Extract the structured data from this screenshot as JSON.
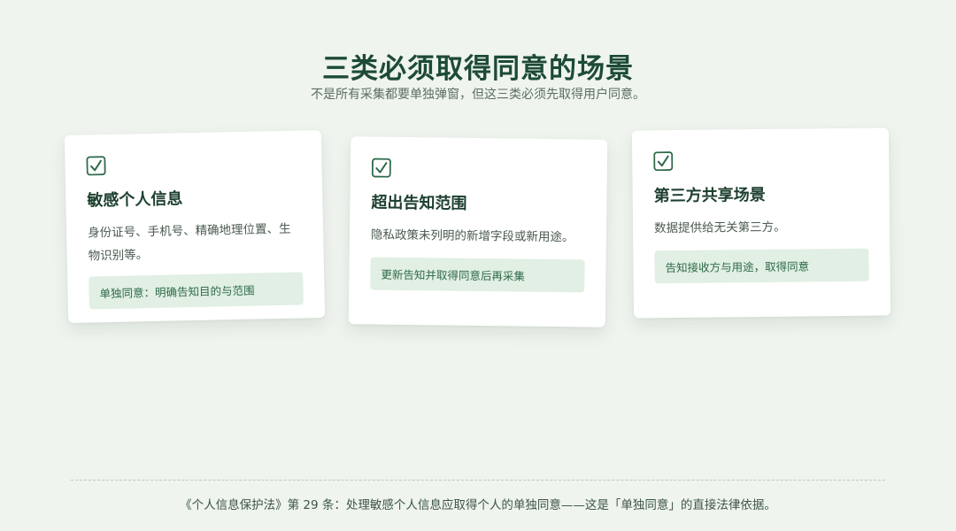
{
  "header": {
    "title": "三类必须取得同意的场景",
    "subtitle": "不是所有采集都要单独弹窗，但这三类必须先取得用户同意。"
  },
  "cards": [
    {
      "icon": "checkbox-checked-icon",
      "title": "敏感个人信息",
      "desc": "身份证号、手机号、精确地理位置、生物识别等。",
      "note": "单独同意：明确告知目的与范围"
    },
    {
      "icon": "checkbox-checked-icon",
      "title": "超出告知范围",
      "desc": "隐私政策未列明的新增字段或新用途。",
      "note": "更新告知并取得同意后再采集"
    },
    {
      "icon": "checkbox-checked-icon",
      "title": "第三方共享场景",
      "desc": "数据提供给无关第三方。",
      "note": "告知接收方与用途，取得同意"
    }
  ],
  "footer": {
    "text": "《个人信息保护法》第 29 条：处理敏感个人信息应取得个人的单独同意——这是「单独同意」的直接法律依据。"
  },
  "colors": {
    "background": "#eff4ee",
    "accent": "#2e6a49",
    "note_background": "#e1efe4"
  }
}
